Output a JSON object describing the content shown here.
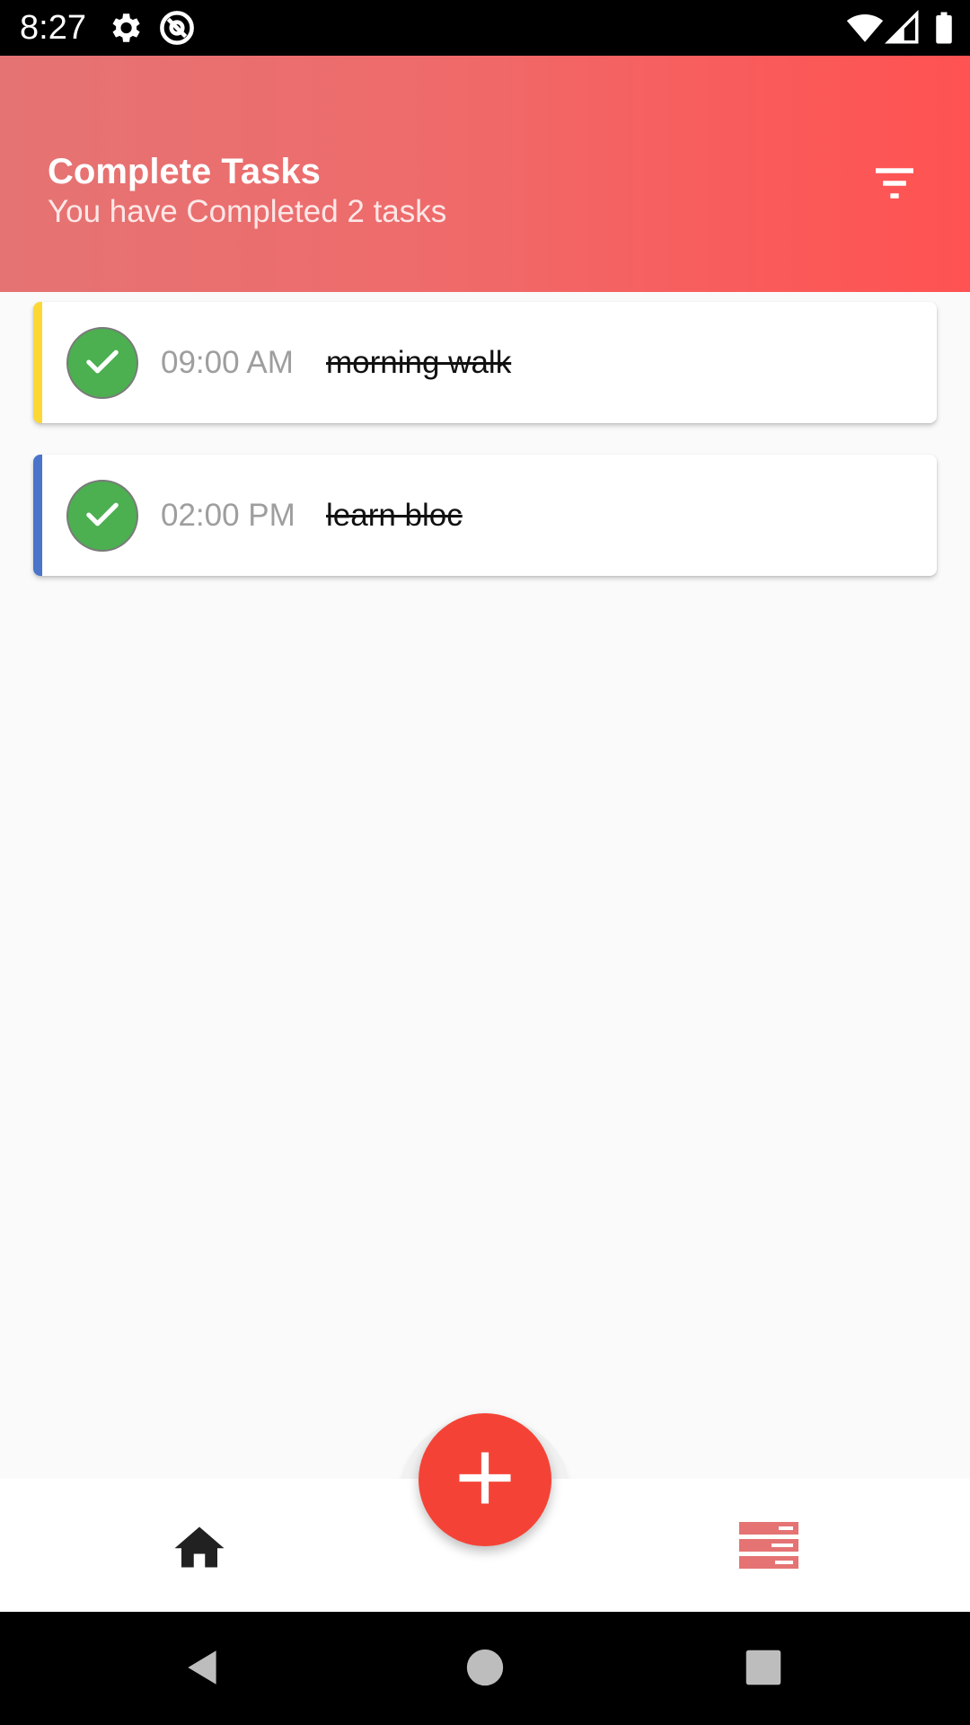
{
  "status_bar": {
    "time": "8:27",
    "icons": [
      "gear-icon",
      "at-sign-icon",
      "wifi-icon",
      "signal-icon",
      "battery-icon"
    ]
  },
  "header": {
    "title": "Complete Tasks",
    "subtitle": "You have Completed 2 tasks",
    "filter_icon": "filter-icon",
    "gradient_colors": [
      "#e57373",
      "#ff5252"
    ]
  },
  "tasks": [
    {
      "time": "09:00 AM",
      "title": "morning walk",
      "accent_color": "#fdd835",
      "completed": true
    },
    {
      "time": "02:00 PM",
      "title": "learn bloc",
      "accent_color": "#4a74c9",
      "completed": true
    }
  ],
  "bottom_nav": {
    "items": [
      {
        "icon": "home-icon",
        "color": "#212121"
      },
      {
        "icon": "task-list-icon",
        "color": "#e57373"
      }
    ],
    "fab_icon": "plus-icon",
    "fab_color": "#f44336"
  },
  "system_nav": {
    "icons": [
      "back-icon",
      "home-circle-icon",
      "recents-icon"
    ]
  }
}
